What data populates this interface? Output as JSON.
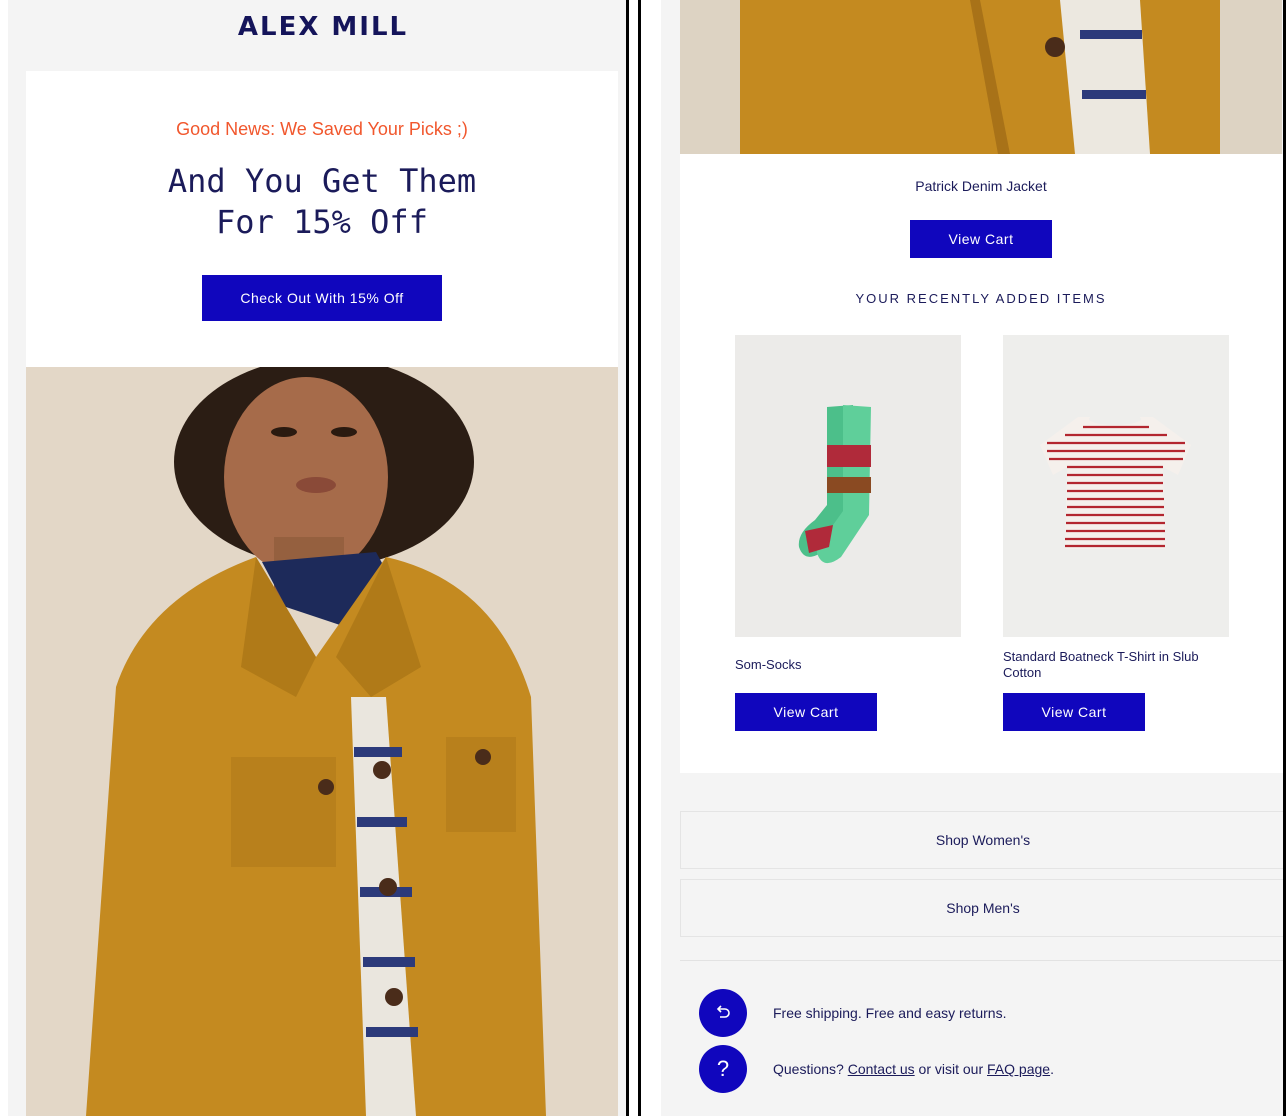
{
  "brand": {
    "logo": "ALEX MILL"
  },
  "promo": {
    "eyebrow": "Good News: We Saved Your Picks ;)",
    "headline_line1": "And You Get Them",
    "headline_line2": "For 15% Off",
    "cta_label": "Check Out With 15% Off"
  },
  "featured": {
    "name": "Patrick Denim Jacket",
    "button_label": "View Cart"
  },
  "recent": {
    "title": "YOUR RECENTLY ADDED ITEMS",
    "items": [
      {
        "name": "Som-Socks",
        "button_label": "View Cart"
      },
      {
        "name": "Standard Boatneck T-Shirt in Slub Cotton",
        "button_label": "View Cart"
      }
    ]
  },
  "shop_links": [
    {
      "label": "Shop Women's"
    },
    {
      "label": "Shop Men's"
    }
  ],
  "footer": {
    "shipping_icon": "return-arrow-icon",
    "shipping_text": "Free shipping. Free and easy returns.",
    "help_icon": "question-icon",
    "help_prefix": "Questions?",
    "contact_link": "Contact us",
    "help_middle": "or visit our",
    "faq_link": "FAQ page",
    "help_suffix": "."
  },
  "colors": {
    "accent": "#1006bd",
    "eyebrow": "#f1572d",
    "text": "#1b1b5a",
    "background": "#f4f4f4"
  }
}
